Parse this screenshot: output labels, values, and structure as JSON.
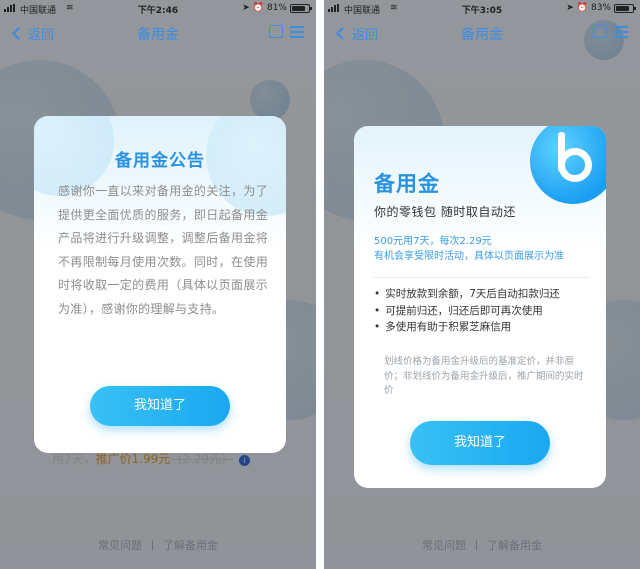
{
  "left": {
    "status": {
      "carrier": "中国联通",
      "time": "下午2:46",
      "battery": "81%",
      "battery_level": 0.81
    },
    "nav": {
      "back_label": "返回",
      "title": "备用金"
    },
    "background": {
      "rate_prefix": "用7天，",
      "rate_promo": "推广价1.99元",
      "rate_original": "（2.29元）"
    },
    "dialog": {
      "title": "备用金公告",
      "body": "感谢你一直以来对备用金的关注，为了提供更全面优质的服务，即日起备用金产品将进行升级调整，调整后备用金将不再限制每月使用次数。同时，在使用时将收取一定的费用（具体以页面展示为准），感谢你的理解与支持。",
      "button_label": "我知道了"
    },
    "bottom_links": {
      "faq": "常见问题",
      "learn": "了解备用金"
    }
  },
  "right": {
    "status": {
      "carrier": "中国联通",
      "time": "下午3:05",
      "battery": "83%",
      "battery_level": 0.83
    },
    "nav": {
      "back_label": "返回",
      "title": "备用金"
    },
    "dialog": {
      "title": "备用金",
      "subtitle": "你的零钱包  随时取自动还",
      "promo_line1": "500元用7天，每次2.29元",
      "promo_line2": "有机会享受限时活动，具体以页面展示为准",
      "features": [
        "实时放款到余额，7天后自动扣款归还",
        "可提前归还，归还后即可再次使用",
        "多使用有助于积累芝麻信用"
      ],
      "note": "划线价格为备用金升级后的基准定价，并非原价；非划线价为备用金升级后，推广期间的实时价",
      "button_label": "我知道了"
    },
    "bottom_links": {
      "faq": "常见问题",
      "learn": "了解备用金"
    }
  },
  "colors": {
    "accent": "#2a93e0",
    "button": "#1aa8f0",
    "promo": "#e0a040"
  }
}
